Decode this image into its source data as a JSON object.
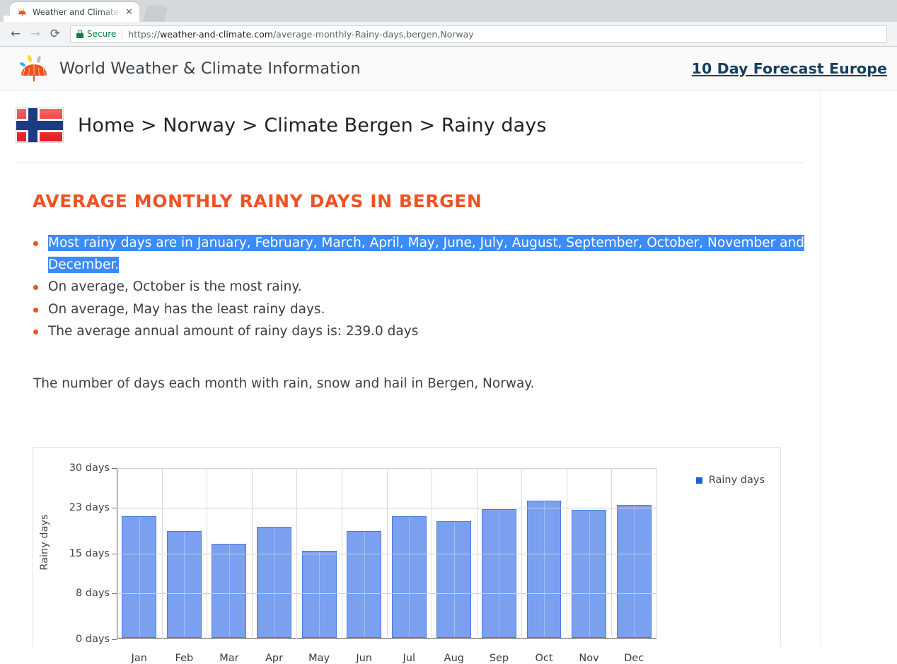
{
  "browser": {
    "tab": {
      "title": "Weather and Climate: Be",
      "favicon_icon": "umbrella-favicon",
      "close_icon": "close-icon"
    },
    "new_tab_icon": "new-tab-button",
    "back_icon": "back-arrow-icon",
    "forward_icon": "forward-arrow-icon",
    "reload_icon": "reload-icon",
    "omnibox": {
      "lock_icon": "lock-icon",
      "security_label": "Secure",
      "url_scheme": "https://",
      "url_host": "weather-and-climate.com",
      "url_path": "/average-monthly-Rainy-days,bergen,Norway",
      "full_url": "https://weather-and-climate.com/average-monthly-Rainy-days,bergen,Norway"
    }
  },
  "site": {
    "logo_icon": "umbrella-logo-icon",
    "name": "World Weather & Climate Information",
    "header_link": "10 Day Forecast Europe"
  },
  "breadcrumb": {
    "flag_icon": "norway-flag-icon",
    "text": "Home > Norway > Climate Bergen > Rainy days",
    "items": [
      "Home",
      "Norway",
      "Climate Bergen",
      "Rainy days"
    ]
  },
  "main": {
    "title": "Average monthly Rainy days in Bergen",
    "facts": [
      {
        "text_selected": "Most rainy days are in January, February, March, April, May, June, July, August, September, October, November and December.",
        "selected": true
      },
      {
        "text": "On average, October is the most rainy.",
        "selected": false
      },
      {
        "text": "On average, May has the least rainy days.",
        "selected": false
      },
      {
        "text": "The average annual amount of rainy days is: 239.0 days",
        "selected": false
      }
    ],
    "lead": "The number of days each month with rain, snow and hail in Bergen, Norway."
  },
  "colors": {
    "heading": "#ef5223",
    "bullet": "#ef5223",
    "selection": "#3b8bfb",
    "header_link": "#17405e",
    "bar_fill": "#7ba0f0",
    "bar_border": "#4a7ae0",
    "legend_swatch": "#1a62d6",
    "secure_green": "#0b8043"
  },
  "chart_data": {
    "type": "bar",
    "title": "",
    "xlabel": "",
    "ylabel": "Rainy days",
    "categories": [
      "Jan",
      "Feb",
      "Mar",
      "Apr",
      "May",
      "Jun",
      "Jul",
      "Aug",
      "Sep",
      "Oct",
      "Nov",
      "Dec"
    ],
    "values": [
      21.3,
      18.7,
      16.5,
      19.5,
      15.2,
      18.7,
      21.3,
      20.4,
      22.6,
      24.0,
      22.4,
      23.3
    ],
    "series": [
      {
        "name": "Rainy days",
        "values": [
          21.3,
          18.7,
          16.5,
          19.5,
          15.2,
          18.7,
          21.3,
          20.4,
          22.6,
          24.0,
          22.4,
          23.3
        ]
      }
    ],
    "ytick_values": [
      0,
      8,
      15,
      23,
      30
    ],
    "ytick_labels": [
      "0 days",
      "8 days",
      "15 days",
      "23 days",
      "30 days"
    ],
    "ylim": [
      0,
      30
    ],
    "grid": true,
    "legend": [
      "Rainy days"
    ],
    "legend_position": "right",
    "unit": "days"
  }
}
